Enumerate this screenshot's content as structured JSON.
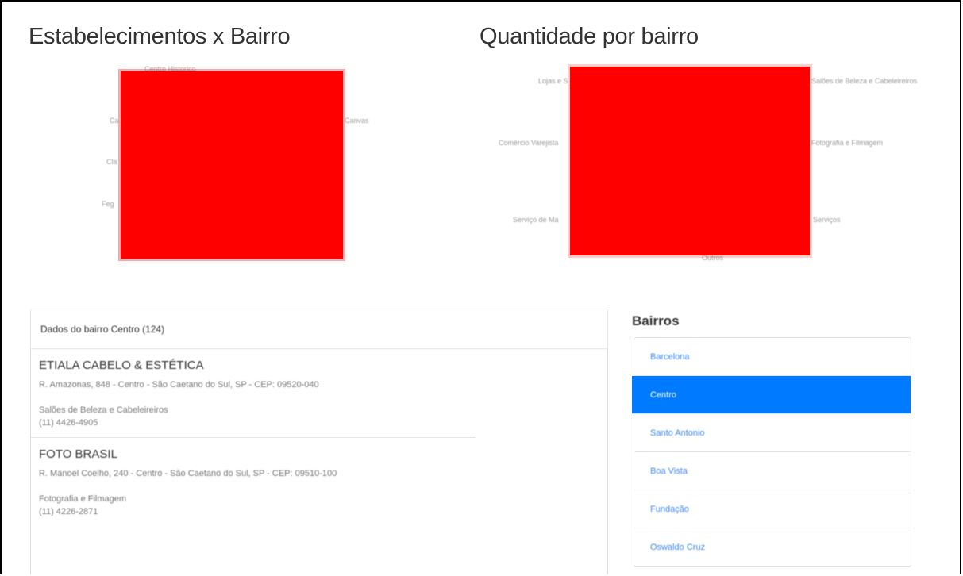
{
  "charts": {
    "left_title": "Estabelecimentos x Bairro",
    "right_title": "Quantidade por bairro",
    "left_labels": [
      "Centro Historico",
      "Ca",
      "Canvas",
      "Cla",
      "Feg"
    ],
    "right_labels": [
      "Lojas e S",
      "Salões de Beleza e Cabeleireiros",
      "Comércio Varejista",
      "Fotografia e Filmagem",
      "Serviço de Ma",
      "Outros",
      "Serviços"
    ],
    "color": "#ff0000"
  },
  "detail": {
    "header": "Dados do bairro Centro (124)",
    "establishments": [
      {
        "name": "ETIALA CABELO & ESTÉTICA",
        "address": "R. Amazonas, 848 - Centro - São Caetano do Sul, SP - CEP: 09520-040",
        "category": "Salões de Beleza e Cabeleireiros",
        "phone": "(11) 4426-4905"
      },
      {
        "name": "FOTO BRASIL",
        "address": "R. Manoel Coelho, 240 - Centro - São Caetano do Sul, SP - CEP: 09510-100",
        "category": "Fotografia e Filmagem",
        "phone": "(11) 4226-2871"
      }
    ]
  },
  "bairros": {
    "heading": "Bairros",
    "items": [
      "Barcelona",
      "Centro",
      "Santo Antonio",
      "Boa Vista",
      "Fundação",
      "Oswaldo Cruz"
    ],
    "active_index": 1,
    "link_color": "#3d8bfd",
    "active_color": "#007bff"
  }
}
